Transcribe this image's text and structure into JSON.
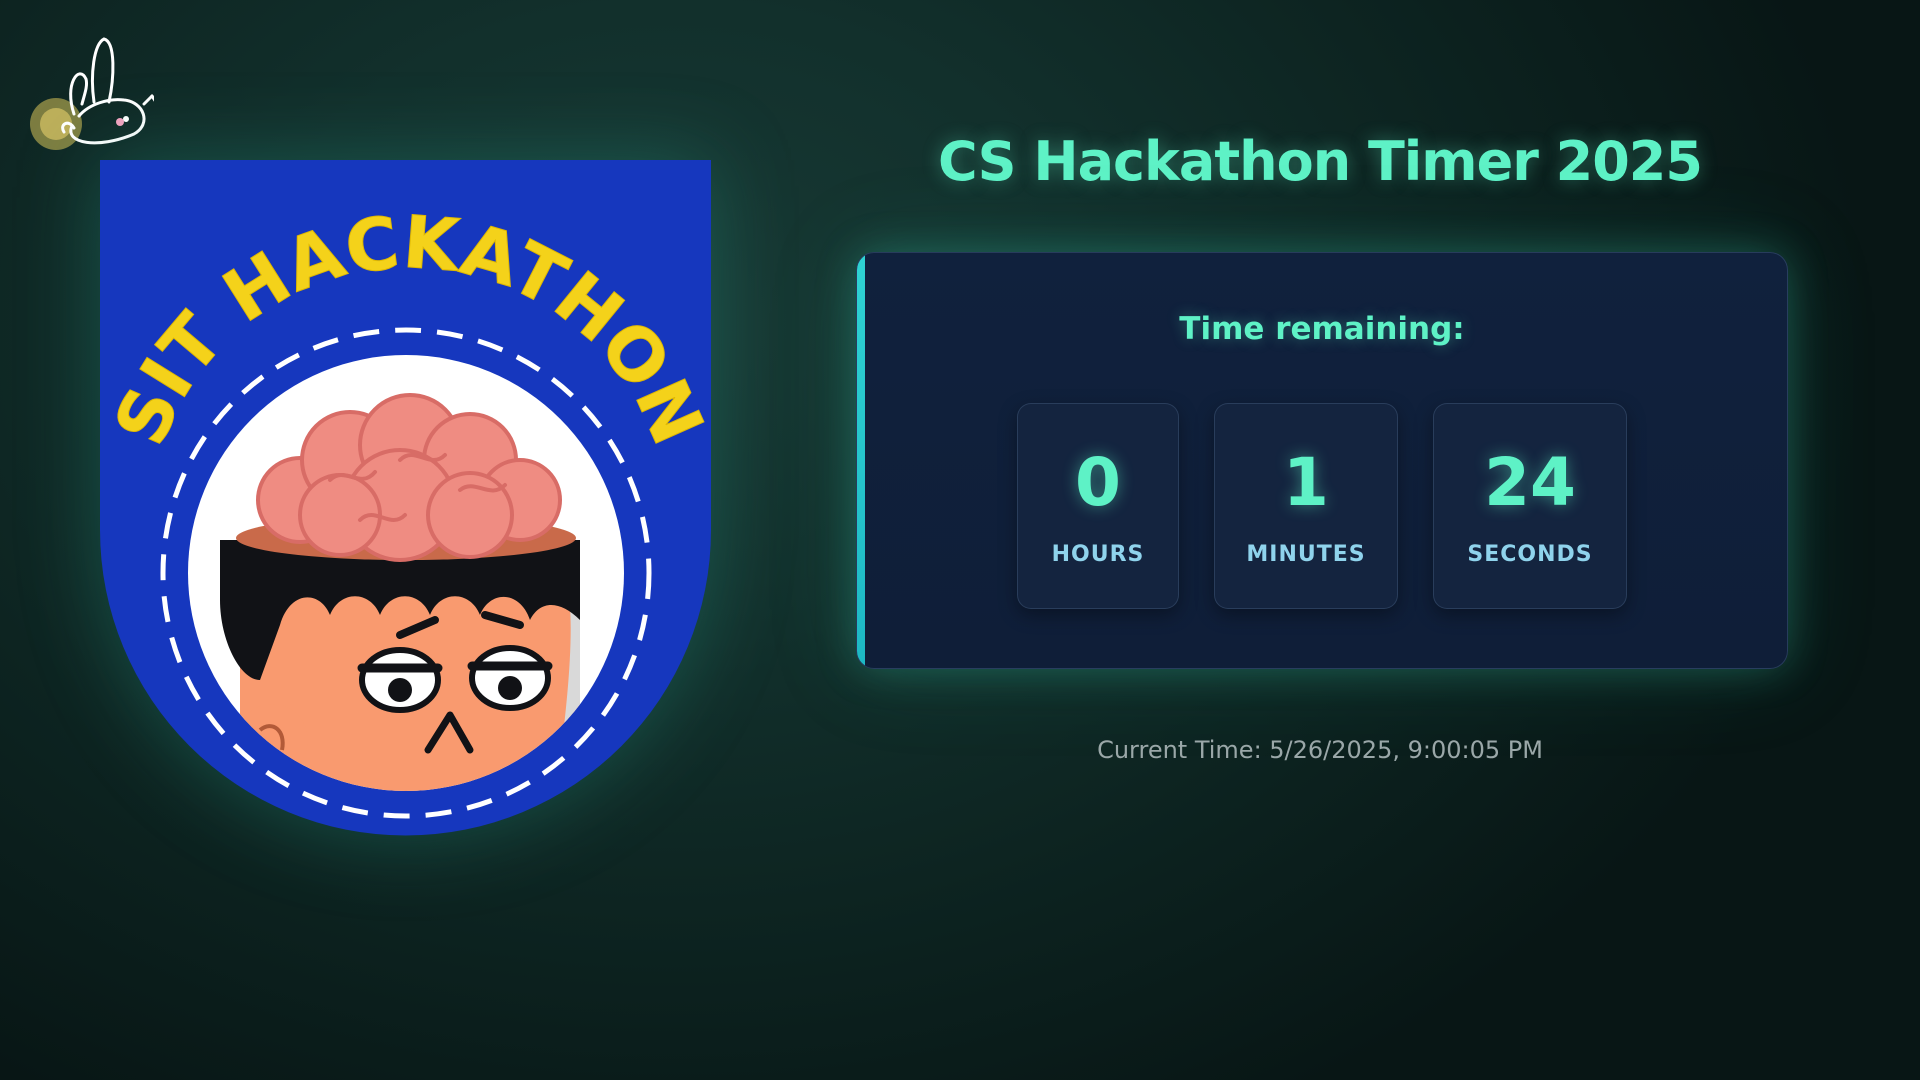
{
  "page": {
    "title": "CS Hackathon Timer 2025"
  },
  "logo": {
    "text": "SIT HACKATHON",
    "colors": {
      "background": "#1637be",
      "text": "#f4d21a",
      "inner": "#ffffff"
    }
  },
  "mascot": {
    "icon": "bunny-icon"
  },
  "timer": {
    "label": "Time remaining:",
    "hours": {
      "value": "0",
      "label": "HOURS"
    },
    "minutes": {
      "value": "1",
      "label": "MINUTES"
    },
    "seconds": {
      "value": "24",
      "label": "SECONDS"
    }
  },
  "clock": {
    "text": "Current Time: 5/26/2025, 9:00:05 PM"
  },
  "colors": {
    "accent": "#5ef2c6",
    "card": "#10213d",
    "unit_label": "#8fd3ec"
  }
}
